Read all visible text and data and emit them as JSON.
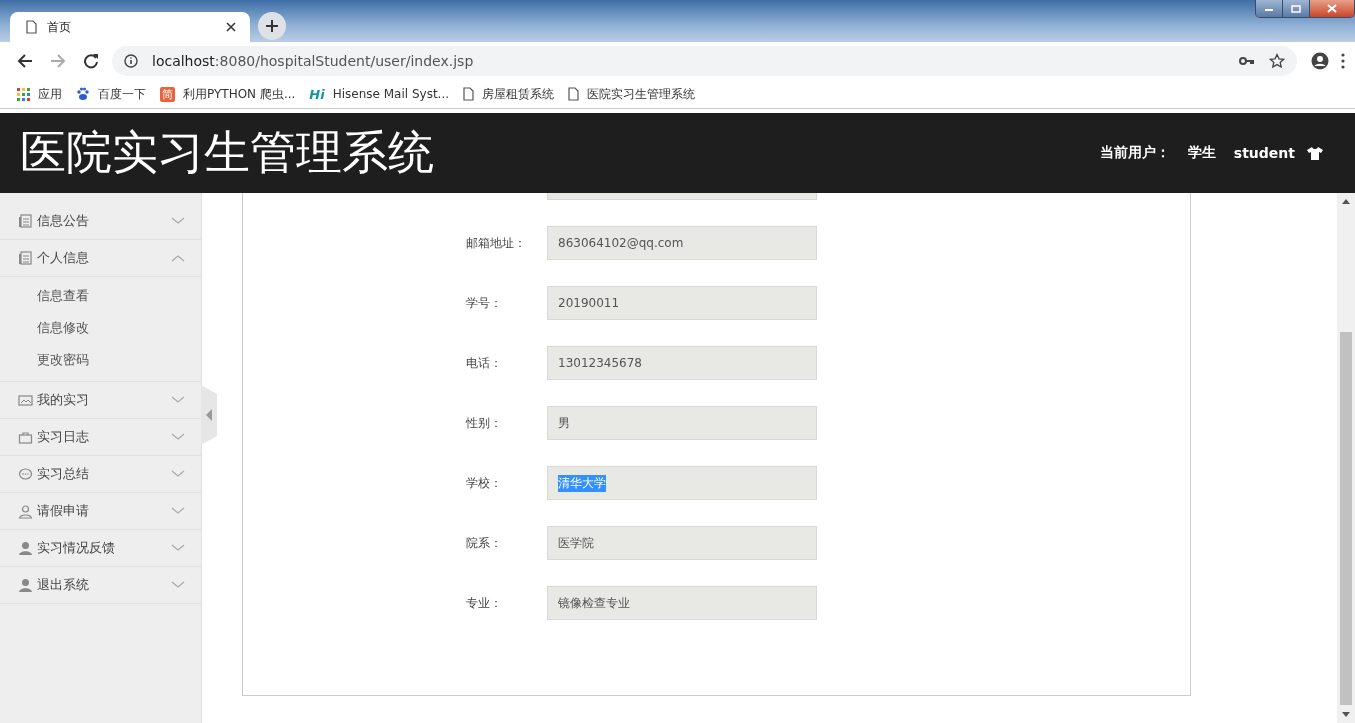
{
  "browser": {
    "tab": {
      "title": "首页"
    },
    "address": {
      "host": "localhost",
      "path": ":8080/hospitalStudent/user/index.jsp"
    },
    "bookmarks": [
      {
        "kind": "apps",
        "label": "应用"
      },
      {
        "kind": "paw",
        "label": "百度一下"
      },
      {
        "kind": "badge",
        "badge": "简",
        "label": "利用PYTHON 爬虫..."
      },
      {
        "kind": "logo",
        "badge": "Hi",
        "label": "Hisense Mail Syst..."
      },
      {
        "kind": "page",
        "label": "房屋租赁系统"
      },
      {
        "kind": "page",
        "label": "医院实习生管理系统"
      }
    ]
  },
  "header": {
    "title": "医院实习生管理系统",
    "user_label": "当前用户：",
    "role": "学生",
    "username": "student"
  },
  "sidebar": {
    "items": [
      {
        "label": "信息公告",
        "expanded": false
      },
      {
        "label": "个人信息",
        "expanded": true,
        "children": [
          {
            "label": "信息查看"
          },
          {
            "label": "信息修改"
          },
          {
            "label": "更改密码"
          }
        ]
      },
      {
        "label": "我的实习",
        "expanded": false
      },
      {
        "label": "实习日志",
        "expanded": false
      },
      {
        "label": "实习总结",
        "expanded": false
      },
      {
        "label": "请假申请",
        "expanded": false
      },
      {
        "label": "实习情况反馈",
        "expanded": false
      },
      {
        "label": "退出系统",
        "expanded": false
      }
    ]
  },
  "form": {
    "fields": [
      {
        "label": "邮箱地址：",
        "value": "863064102@qq.com",
        "highlighted": false
      },
      {
        "label": "学号：",
        "value": "20190011",
        "highlighted": false
      },
      {
        "label": "电话：",
        "value": "13012345678",
        "highlighted": false
      },
      {
        "label": "性别：",
        "value": "男",
        "highlighted": false
      },
      {
        "label": "学校：",
        "value": "清华大学",
        "highlighted": true
      },
      {
        "label": "院系：",
        "value": "医学院",
        "highlighted": false
      },
      {
        "label": "专业：",
        "value": "镜像检查专业",
        "highlighted": false
      }
    ]
  }
}
